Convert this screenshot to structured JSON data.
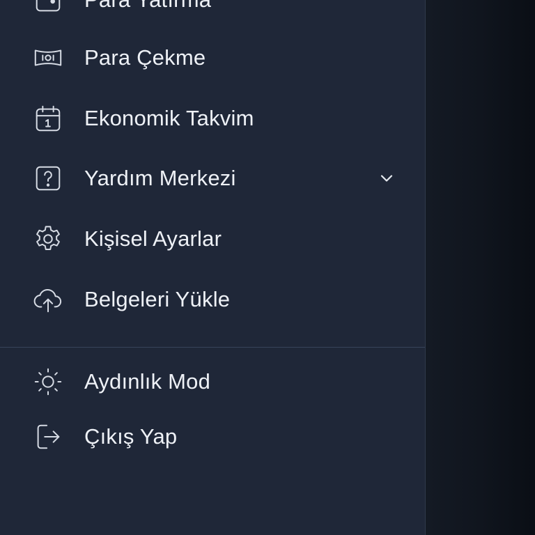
{
  "menu": {
    "items": [
      {
        "label": "Para Yatırma",
        "icon": "deposit-wallet-icon"
      },
      {
        "label": "Para Çekme",
        "icon": "banknote-icon"
      },
      {
        "label": "Ekonomik Takvim",
        "icon": "calendar-icon"
      },
      {
        "label": "Yardım Merkezi",
        "icon": "help-question-icon",
        "expandable": true
      },
      {
        "label": "Kişisel Ayarlar",
        "icon": "gear-icon"
      },
      {
        "label": "Belgeleri Yükle",
        "icon": "cloud-upload-icon"
      }
    ],
    "secondary": [
      {
        "label": "Aydınlık Mod",
        "icon": "sun-icon"
      },
      {
        "label": "Çıkış Yap",
        "icon": "logout-icon"
      }
    ]
  },
  "colors": {
    "drawer_bg": "#1f2738",
    "text": "#eef1f6",
    "icon": "#d6dbe4",
    "divider": "#38445a",
    "backdrop": "#0d121b"
  }
}
